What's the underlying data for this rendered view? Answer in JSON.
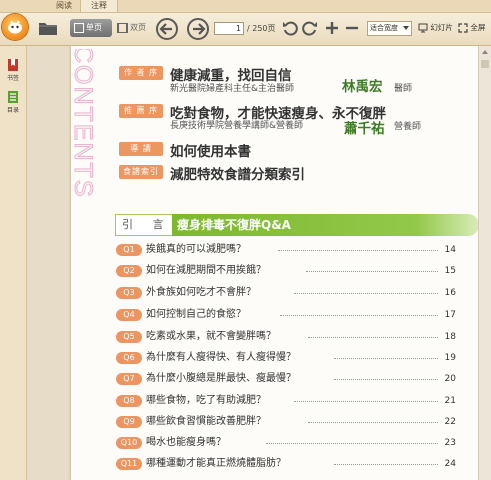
{
  "tabs": [
    {
      "label": "阅读"
    },
    {
      "label": "注释"
    }
  ],
  "toolbar": {
    "single_page_label": "单页",
    "double_page_label": "双页",
    "page_current": "1",
    "page_total": "/ 250页",
    "zoom_value": "适合宽度",
    "slideshow_label": "幻灯片",
    "fullscreen_label": "全屏"
  },
  "sidebar": {
    "items": [
      {
        "label": "书签",
        "icon": "bookmark-icon"
      },
      {
        "label": "目录",
        "icon": "toc-icon"
      }
    ]
  },
  "page": {
    "contents_word": "CONTENTS",
    "entries": [
      {
        "badge": "作 者 序",
        "title": "健康減重，找回自信",
        "subtitle": "新光醫院婦產科主任&主治醫師",
        "signature": "林禹宏",
        "role": "醫師"
      },
      {
        "badge": "推 薦 序",
        "title": "吃對食物，才能快速瘦身、永不復胖",
        "subtitle": "長庚技術學院營養學講師&營養師",
        "signature": "蕭千祐",
        "role": "營養師"
      },
      {
        "badge": "導    讀",
        "title": "如何使用本書"
      },
      {
        "badge": "食譜索引",
        "title": "減肥特效食譜分類索引"
      }
    ],
    "section": {
      "left": "引 言",
      "title": "瘦身排毒不復胖Q&A"
    },
    "questions": [
      {
        "badge": "Q1",
        "text": "挨餓真的可以減肥嗎？",
        "page": "14"
      },
      {
        "badge": "Q2",
        "text": "如何在減肥期間不用挨餓？",
        "page": "15"
      },
      {
        "badge": "Q3",
        "text": "外食族如何吃才不會胖？",
        "page": "16"
      },
      {
        "badge": "Q4",
        "text": "如何控制自己的食慾？",
        "page": "17"
      },
      {
        "badge": "Q5",
        "text": "吃素或水果，就不會變胖嗎？",
        "page": "18"
      },
      {
        "badge": "Q6",
        "text": "為什麼有人瘦得快、有人瘦得慢？",
        "page": "19"
      },
      {
        "badge": "Q7",
        "text": "為什麼小腹總是胖最快、瘦最慢？",
        "page": "20"
      },
      {
        "badge": "Q8",
        "text": "哪些食物，吃了有助減肥？",
        "page": "21"
      },
      {
        "badge": "Q9",
        "text": "哪些飲食習慣能改善肥胖？",
        "page": "22"
      },
      {
        "badge": "Q10",
        "text": "喝水也能瘦身嗎？",
        "page": "23"
      },
      {
        "badge": "Q11",
        "text": "哪種運動才能真正燃燒體脂肪？",
        "page": "24"
      }
    ]
  },
  "colors": {
    "badge_orange": "#eb9563",
    "banner_green": "#7db82f",
    "signature_green": "#3e7d25",
    "contents_pink": "#e9b7cf"
  }
}
